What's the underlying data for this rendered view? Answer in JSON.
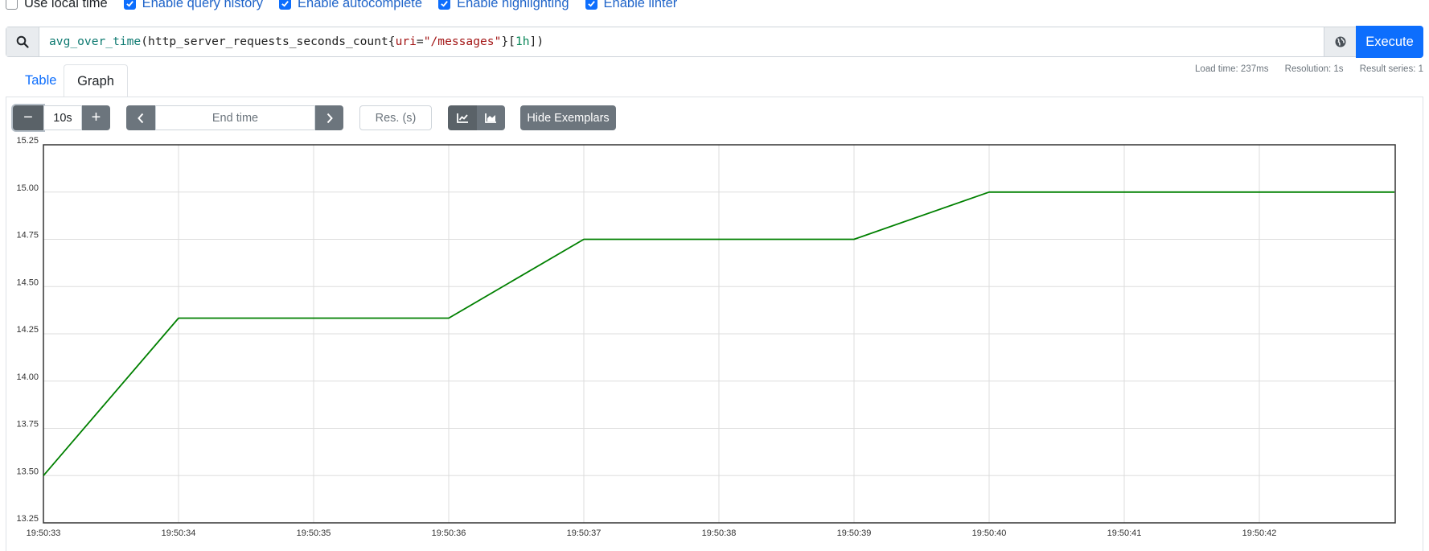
{
  "options": [
    {
      "label": "Use local time",
      "checked": false
    },
    {
      "label": "Enable query history",
      "checked": true
    },
    {
      "label": "Enable autocomplete",
      "checked": true
    },
    {
      "label": "Enable highlighting",
      "checked": true
    },
    {
      "label": "Enable linter",
      "checked": true
    }
  ],
  "query": {
    "fn": "avg_over_time",
    "open_paren": "(",
    "metric": "http_server_requests_seconds_count",
    "brace_open": "{",
    "label_name": "uri",
    "eq": "=",
    "label_value": "\"/messages\"",
    "brace_close_bracket": "}[",
    "range": "1h",
    "close": "])"
  },
  "execute_label": "Execute",
  "tabs": {
    "table": "Table",
    "graph": "Graph"
  },
  "stats": {
    "load_time": "Load time: 237ms",
    "resolution": "Resolution: 1s",
    "result_series": "Result series: 1"
  },
  "controls": {
    "minus": "−",
    "range": "10s",
    "plus": "+",
    "end_time_placeholder": "End time",
    "resolution_placeholder": "Res. (s)",
    "hide_exemplars": "Hide Exemplars"
  },
  "icons": {
    "search": "search-icon",
    "metrics_explorer": "globe-icon",
    "prev": "chevron-left-icon",
    "next": "chevron-right-icon",
    "line_chart": "line-chart-icon",
    "stacked_chart": "area-chart-icon"
  },
  "colors": {
    "accent": "#0d6efd",
    "series": "#008000",
    "grid": "#dddddd"
  },
  "chart_data": {
    "type": "line",
    "title": "",
    "xlabel": "",
    "ylabel": "",
    "ylim": [
      13.25,
      15.25
    ],
    "y_ticks": [
      "13.25",
      "13.50",
      "13.75",
      "14.00",
      "14.25",
      "14.50",
      "14.75",
      "15.00",
      "15.25"
    ],
    "x_ticks": [
      "19:50:33",
      "19:50:34",
      "19:50:35",
      "19:50:36",
      "19:50:37",
      "19:50:38",
      "19:50:39",
      "19:50:40",
      "19:50:41",
      "19:50:42"
    ],
    "grid": true,
    "series": [
      {
        "name": "",
        "x": [
          "19:50:33",
          "19:50:34",
          "19:50:36",
          "19:50:37",
          "19:50:39",
          "19:50:40",
          "19:50:43"
        ],
        "y": [
          13.5,
          14.333,
          14.333,
          14.75,
          14.75,
          15.0,
          15.0
        ]
      }
    ]
  }
}
